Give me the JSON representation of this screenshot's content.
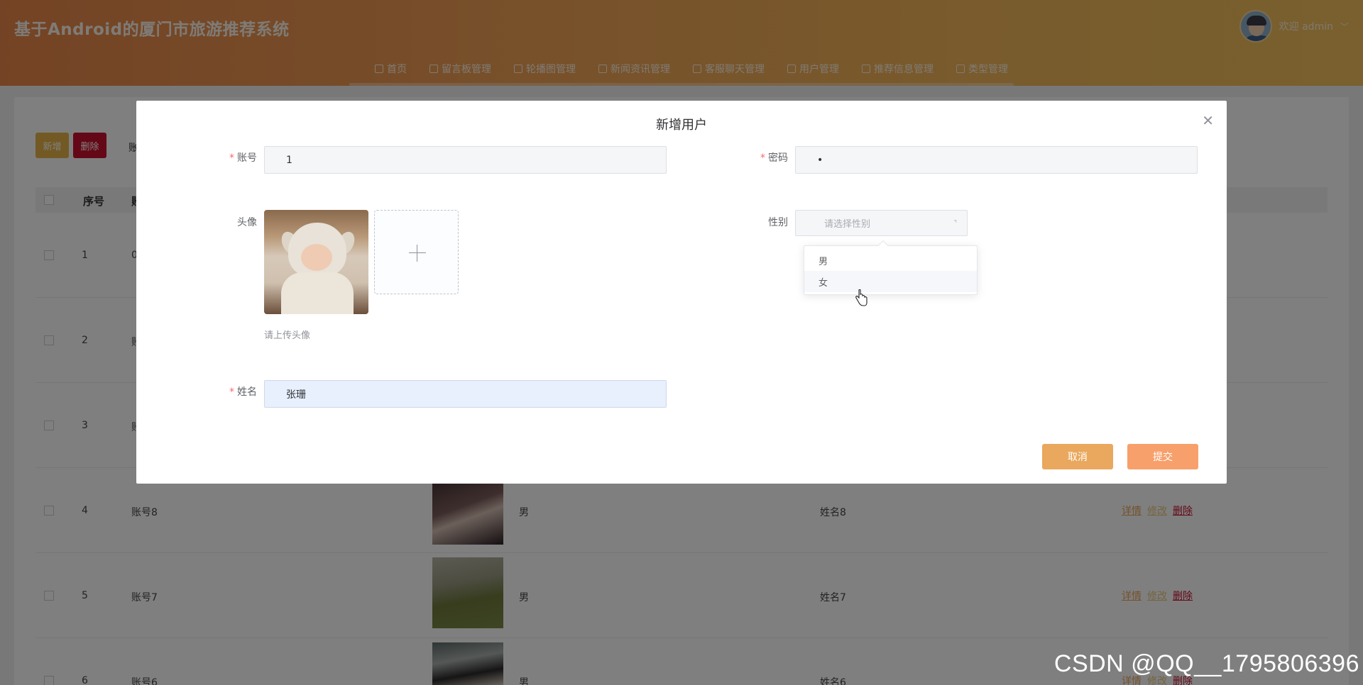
{
  "header": {
    "site_title": "基于Android的厦门市旅游推荐系统",
    "welcome": "欢迎 admin",
    "nav": [
      {
        "label": "首页",
        "icon": "home-icon"
      },
      {
        "label": "留言板管理",
        "icon": "table-icon"
      },
      {
        "label": "轮播图管理",
        "icon": "table-icon"
      },
      {
        "label": "新闻资讯管理",
        "icon": "table-icon"
      },
      {
        "label": "客服聊天管理",
        "icon": "table-icon"
      },
      {
        "label": "用户管理",
        "icon": "user-icon"
      },
      {
        "label": "推荐信息管理",
        "icon": "table-icon"
      },
      {
        "label": "类型管理",
        "icon": "table-icon"
      }
    ]
  },
  "list": {
    "add_label": "新增",
    "delete_label": "删除",
    "partial_search_label": "账",
    "head_seq": "序号",
    "head_partial": "账",
    "rows": [
      {
        "seq": "1",
        "account": "0"
      },
      {
        "seq": "2",
        "account": "账"
      },
      {
        "seq": "3",
        "account": "账"
      },
      {
        "seq": "4",
        "account": "账号8",
        "gender": "男",
        "name": "姓名8"
      },
      {
        "seq": "5",
        "account": "账号7",
        "gender": "男",
        "name": "姓名7"
      },
      {
        "seq": "6",
        "account": "账号6",
        "gender": "男",
        "name": "姓名6"
      }
    ],
    "op_detail": "详情",
    "op_edit": "修改",
    "op_delete": "删除"
  },
  "dialog": {
    "title": "新增用户",
    "close_icon": "close-icon",
    "account_label": "账号",
    "account_value": "1",
    "password_label": "密码",
    "password_value": "•",
    "avatar_label": "头像",
    "avatar_tip": "请上传头像",
    "gender_label": "性别",
    "gender_placeholder": "请选择性别",
    "gender_options": [
      "男",
      "女"
    ],
    "name_label": "姓名",
    "name_value": "张珊",
    "cancel_label": "取消",
    "submit_label": "提交"
  },
  "watermark": "CSDN @QQ__1795806396",
  "colors": {
    "header_start": "#e8874a",
    "header_end": "#f2c15c",
    "cancel_button": "#e9a85d",
    "submit_button": "#f7a06b",
    "required": "#f56c6c",
    "delete_red": "#c8102e"
  }
}
